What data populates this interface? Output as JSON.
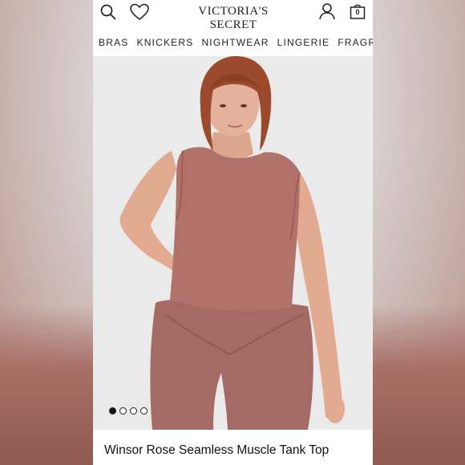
{
  "header": {
    "brand": "VICTORIA'S SECRET",
    "bag_count": "0",
    "icons": [
      "search-icon",
      "heart-icon",
      "account-icon",
      "bag-icon"
    ]
  },
  "nav": {
    "items": [
      "BRAS",
      "KNICKERS",
      "NIGHTWEAR",
      "LINGERIE",
      "FRAGRAN"
    ]
  },
  "gallery": {
    "image_count": 4,
    "active_index": 0
  },
  "product": {
    "title": "Winsor Rose Seamless Muscle Tank Top"
  },
  "colors": {
    "garment": "#b0726a",
    "background": "#ebe9ea"
  }
}
